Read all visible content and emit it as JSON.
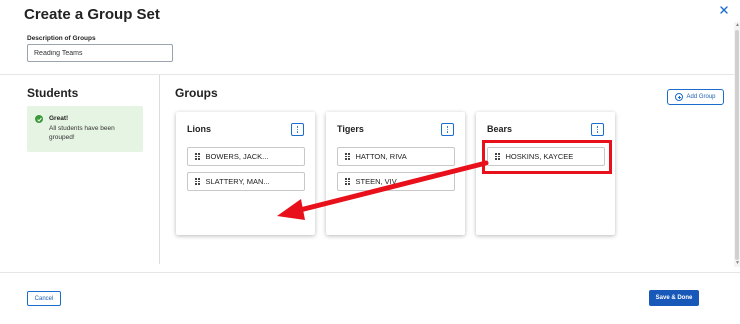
{
  "dialog": {
    "title": "Create a Group Set",
    "close_icon": "close-icon"
  },
  "description": {
    "label": "Description of Groups",
    "value": "Reading Teams"
  },
  "students_panel": {
    "heading": "Students",
    "status": {
      "icon": "check-circle-icon",
      "title": "Great!",
      "message": "All students have been grouped!",
      "color": "#3c9a3a",
      "background": "#e6f4e3"
    }
  },
  "groups_panel": {
    "heading": "Groups",
    "add_group_label": "Add Group",
    "groups": [
      {
        "name": "Lions",
        "members": [
          "BOWERS, JACK...",
          "SLATTERY, MAN..."
        ]
      },
      {
        "name": "Tigers",
        "members": [
          "HATTON, RIVA",
          "STEEN, VIV"
        ]
      },
      {
        "name": "Bears",
        "members": [
          "HOSKINS, KAYCEE"
        ]
      }
    ]
  },
  "annotation": {
    "highlight_color": "#e8101b",
    "highlighted_student": "HOSKINS, KAYCEE",
    "arrow_target_group": "Lions"
  },
  "footer": {
    "cancel_label": "Cancel",
    "save_label": "Save & Done",
    "accent_color": "#1758b8"
  }
}
